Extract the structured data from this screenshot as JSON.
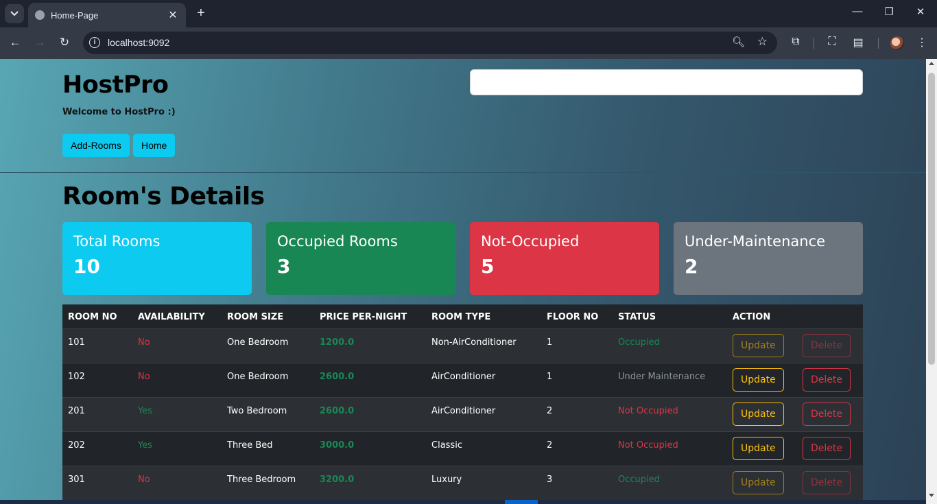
{
  "browser": {
    "tab_title": "Home-Page",
    "url": "localhost:9092"
  },
  "header": {
    "brand": "HostPro",
    "welcome": "Welcome to HostPro :)",
    "search_value": "",
    "buttons": {
      "add_rooms": "Add-Rooms",
      "home": "Home"
    }
  },
  "main": {
    "heading": "Room's Details",
    "cards": [
      {
        "title": "Total Rooms",
        "value": "10",
        "color": "#0dcaf0"
      },
      {
        "title": "Occupied Rooms",
        "value": "3",
        "color": "#198754"
      },
      {
        "title": "Not-Occupied",
        "value": "5",
        "color": "#dc3545"
      },
      {
        "title": "Under-Maintenance",
        "value": "2",
        "color": "#6c757d"
      }
    ],
    "table": {
      "headers": [
        "ROOM NO",
        "AVAILABILITY",
        "ROOM SIZE",
        "PRICE PER-NIGHT",
        "ROOM TYPE",
        "FLOOR NO",
        "STATUS",
        "ACTION"
      ],
      "rows": [
        {
          "room_no": "101",
          "availability": "No",
          "room_size": "One Bedroom",
          "price": "1200.0",
          "room_type": "Non-AirConditioner",
          "floor": "1",
          "status": "Occupied"
        },
        {
          "room_no": "102",
          "availability": "No",
          "room_size": "One Bedroom",
          "price": "2600.0",
          "room_type": "AirConditioner",
          "floor": "1",
          "status": "Under Maintenance"
        },
        {
          "room_no": "201",
          "availability": "Yes",
          "room_size": "Two Bedroom",
          "price": "2600.0",
          "room_type": "AirConditioner",
          "floor": "2",
          "status": "Not Occupied"
        },
        {
          "room_no": "202",
          "availability": "Yes",
          "room_size": "Three Bed",
          "price": "3000.0",
          "room_type": "Classic",
          "floor": "2",
          "status": "Not Occupied"
        },
        {
          "room_no": "301",
          "availability": "No",
          "room_size": "Three Bedroom",
          "price": "3200.0",
          "room_type": "Luxury",
          "floor": "3",
          "status": "Occupied"
        }
      ],
      "update_label": "Update",
      "delete_label": "Delete"
    }
  }
}
